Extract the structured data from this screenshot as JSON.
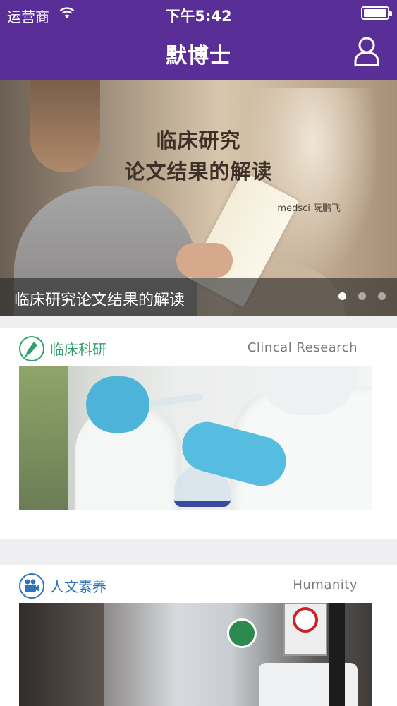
{
  "status_bar": {
    "carrier": "运营商",
    "time": "下午5:42"
  },
  "nav": {
    "title": "默博士"
  },
  "banner": {
    "headline_line1": "临床研究",
    "headline_line2": "论文结果的解读",
    "signature": "medsci 阮鹏飞",
    "caption": "临床研究论文结果的解读",
    "page_count": 3,
    "active_page": 1
  },
  "sections": [
    {
      "title": "临床科研",
      "subtitle_en": "Clincal Research",
      "icon": "pen-icon",
      "color": "#2e9f6d"
    },
    {
      "title": "人文素养",
      "subtitle_en": "Humanity",
      "icon": "video-camera-icon",
      "color": "#2f73b8"
    }
  ],
  "colors": {
    "nav_background": "#5a2e97",
    "page_background": "#efeef1"
  }
}
